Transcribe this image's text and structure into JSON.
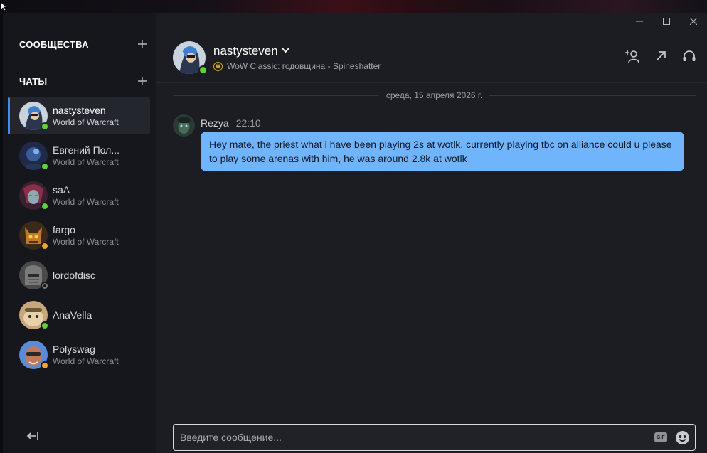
{
  "window": {
    "minimize_icon": "minimize-icon",
    "maximize_icon": "maximize-icon",
    "close_icon": "close-icon"
  },
  "sidebar": {
    "communities_label": "СООБЩЕСТВА",
    "chats_label": "ЧАТЫ",
    "add_icon": "plus-icon",
    "collapse_icon": "collapse-sidebar-icon",
    "chats": [
      {
        "name": "nastysteven",
        "game": "World of Warcraft",
        "status": "online",
        "active": true
      },
      {
        "name": "Евгений Пол...",
        "game": "World of Warcraft",
        "status": "online"
      },
      {
        "name": "saA",
        "game": "World of Warcraft",
        "status": "online"
      },
      {
        "name": "fargo",
        "game": "World of Warcraft",
        "status": "away"
      },
      {
        "name": "lordofdisc",
        "game": "",
        "status": "offline"
      },
      {
        "name": "AnaVella",
        "game": "",
        "status": "online"
      },
      {
        "name": "Polyswag",
        "game": "World of Warcraft",
        "status": "away"
      }
    ]
  },
  "header": {
    "name": "nastysteven",
    "game_status": "WoW Classic: годовщина - Spineshatter",
    "status": "online",
    "actions": [
      "add-friend-icon",
      "open-external-icon",
      "voice-chat-icon"
    ]
  },
  "conversation": {
    "date": "среда, 15 апреля 2026 г.",
    "messages": [
      {
        "author": "Rezya",
        "time": "22:10",
        "text": "Hey mate, the priest what i have been playing 2s at wotlk, currently playing tbc on alliance could u please to play some arenas with him, he was around 2.8k at wotlk"
      }
    ]
  },
  "composer": {
    "placeholder": "Введите сообщение...",
    "gif_label": "GIF",
    "emoji_icon": "emoji-icon"
  },
  "colors": {
    "accent": "#3a8ef0",
    "bubble": "#70b4fc",
    "online": "#5fd13d",
    "away": "#f0a62a"
  }
}
